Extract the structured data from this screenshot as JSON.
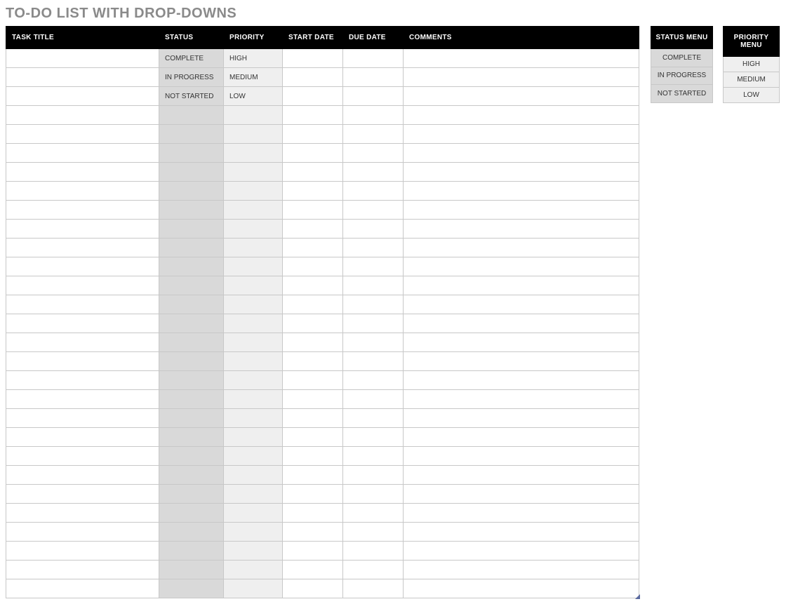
{
  "title": "TO-DO LIST WITH DROP-DOWNS",
  "columns": {
    "task_title": "TASK TITLE",
    "status": "STATUS",
    "priority": "PRIORITY",
    "start_date": "START DATE",
    "due_date": "DUE DATE",
    "comments": "COMMENTS"
  },
  "rows": [
    {
      "task_title": "",
      "status": "COMPLETE",
      "priority": "HIGH",
      "start_date": "",
      "due_date": "",
      "comments": ""
    },
    {
      "task_title": "",
      "status": "IN PROGRESS",
      "priority": "MEDIUM",
      "start_date": "",
      "due_date": "",
      "comments": ""
    },
    {
      "task_title": "",
      "status": "NOT STARTED",
      "priority": "LOW",
      "start_date": "",
      "due_date": "",
      "comments": ""
    },
    {
      "task_title": "",
      "status": "",
      "priority": "",
      "start_date": "",
      "due_date": "",
      "comments": ""
    },
    {
      "task_title": "",
      "status": "",
      "priority": "",
      "start_date": "",
      "due_date": "",
      "comments": ""
    },
    {
      "task_title": "",
      "status": "",
      "priority": "",
      "start_date": "",
      "due_date": "",
      "comments": ""
    },
    {
      "task_title": "",
      "status": "",
      "priority": "",
      "start_date": "",
      "due_date": "",
      "comments": ""
    },
    {
      "task_title": "",
      "status": "",
      "priority": "",
      "start_date": "",
      "due_date": "",
      "comments": ""
    },
    {
      "task_title": "",
      "status": "",
      "priority": "",
      "start_date": "",
      "due_date": "",
      "comments": ""
    },
    {
      "task_title": "",
      "status": "",
      "priority": "",
      "start_date": "",
      "due_date": "",
      "comments": ""
    },
    {
      "task_title": "",
      "status": "",
      "priority": "",
      "start_date": "",
      "due_date": "",
      "comments": ""
    },
    {
      "task_title": "",
      "status": "",
      "priority": "",
      "start_date": "",
      "due_date": "",
      "comments": ""
    },
    {
      "task_title": "",
      "status": "",
      "priority": "",
      "start_date": "",
      "due_date": "",
      "comments": ""
    },
    {
      "task_title": "",
      "status": "",
      "priority": "",
      "start_date": "",
      "due_date": "",
      "comments": ""
    },
    {
      "task_title": "",
      "status": "",
      "priority": "",
      "start_date": "",
      "due_date": "",
      "comments": ""
    },
    {
      "task_title": "",
      "status": "",
      "priority": "",
      "start_date": "",
      "due_date": "",
      "comments": ""
    },
    {
      "task_title": "",
      "status": "",
      "priority": "",
      "start_date": "",
      "due_date": "",
      "comments": ""
    },
    {
      "task_title": "",
      "status": "",
      "priority": "",
      "start_date": "",
      "due_date": "",
      "comments": ""
    },
    {
      "task_title": "",
      "status": "",
      "priority": "",
      "start_date": "",
      "due_date": "",
      "comments": ""
    },
    {
      "task_title": "",
      "status": "",
      "priority": "",
      "start_date": "",
      "due_date": "",
      "comments": ""
    },
    {
      "task_title": "",
      "status": "",
      "priority": "",
      "start_date": "",
      "due_date": "",
      "comments": ""
    },
    {
      "task_title": "",
      "status": "",
      "priority": "",
      "start_date": "",
      "due_date": "",
      "comments": ""
    },
    {
      "task_title": "",
      "status": "",
      "priority": "",
      "start_date": "",
      "due_date": "",
      "comments": ""
    },
    {
      "task_title": "",
      "status": "",
      "priority": "",
      "start_date": "",
      "due_date": "",
      "comments": ""
    },
    {
      "task_title": "",
      "status": "",
      "priority": "",
      "start_date": "",
      "due_date": "",
      "comments": ""
    },
    {
      "task_title": "",
      "status": "",
      "priority": "",
      "start_date": "",
      "due_date": "",
      "comments": ""
    },
    {
      "task_title": "",
      "status": "",
      "priority": "",
      "start_date": "",
      "due_date": "",
      "comments": ""
    },
    {
      "task_title": "",
      "status": "",
      "priority": "",
      "start_date": "",
      "due_date": "",
      "comments": ""
    },
    {
      "task_title": "",
      "status": "",
      "priority": "",
      "start_date": "",
      "due_date": "",
      "comments": ""
    }
  ],
  "status_menu": {
    "header": "STATUS MENU",
    "options": [
      "COMPLETE",
      "IN PROGRESS",
      "NOT STARTED"
    ]
  },
  "priority_menu": {
    "header": "PRIORITY MENU",
    "options": [
      "HIGH",
      "MEDIUM",
      "LOW"
    ]
  }
}
